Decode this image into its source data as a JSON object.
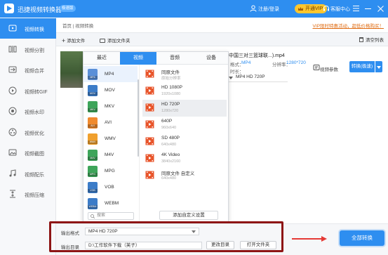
{
  "app": {
    "title": "迅捷视频转换器",
    "version_badge": "极速版",
    "login": "注册/登录",
    "vip": "开通VIP",
    "service": "客服中心"
  },
  "sidebar": {
    "items": [
      {
        "label": "视频转换",
        "icon": "video-convert-icon",
        "active": true
      },
      {
        "label": "视频分割",
        "icon": "split-icon"
      },
      {
        "label": "视频合并",
        "icon": "merge-icon"
      },
      {
        "label": "视频转GIF",
        "icon": "gif-icon"
      },
      {
        "label": "视频水印",
        "icon": "watermark-icon"
      },
      {
        "label": "视频优化",
        "icon": "optimize-icon"
      },
      {
        "label": "视频截图",
        "icon": "screenshot-icon"
      },
      {
        "label": "视频配乐",
        "icon": "music-icon"
      },
      {
        "label": "视频压缩",
        "icon": "compress-icon"
      }
    ]
  },
  "main": {
    "breadcrumb": "首页 | 视频转换",
    "promo": "VIP限时特惠活动，超低价格购买！",
    "add_file": "添加文件",
    "add_folder": "添加文件夹",
    "clear": "清空列表"
  },
  "file": {
    "name": "中国三对三篮球联...).mp4",
    "format_label": "格式：",
    "format_value": "MP4",
    "resolution_label": "分辨率：",
    "resolution_value": "1280*720",
    "duration_label": "时长：",
    "target_format": "MP4  HD 720P",
    "params": "视频参数",
    "convert_btn": "转换(极速)"
  },
  "popup": {
    "tabs": [
      "最近",
      "视频",
      "音频",
      "设备"
    ],
    "active_tab": 1,
    "formats": [
      "MP4",
      "MOV",
      "MKV",
      "AVI",
      "WMV",
      "M4V",
      "MPG",
      "VOB",
      "WEBM"
    ],
    "active_format": 0,
    "presets": [
      {
        "name": "同原文件",
        "res": "原始分辨率"
      },
      {
        "name": "HD 1080P",
        "res": "1920x1080"
      },
      {
        "name": "HD 720P",
        "res": "1280x720"
      },
      {
        "name": "640P",
        "res": "960x640"
      },
      {
        "name": "SD 480P",
        "res": "640x480"
      },
      {
        "name": "4K Video",
        "res": "3840x2160"
      },
      {
        "name": "同原文件 自定义",
        "res": "640x480"
      }
    ],
    "active_preset": 2,
    "search_placeholder": "搜索",
    "custom_btn": "添加自定义设置"
  },
  "bottom": {
    "output_format_label": "输出格式",
    "output_format_value": "MP4  HD 720P",
    "output_dir_label": "输出目录",
    "output_dir_value": "D:\\工作软件下载（芙子）",
    "change_dir": "更改目录",
    "open_folder": "打开文件夹",
    "convert_all": "全部转换"
  },
  "colors": {
    "accent": "#2e8ef0",
    "vip": "#ffc72e",
    "highlight_frame": "#8e1515",
    "arrow": "#e53935"
  }
}
